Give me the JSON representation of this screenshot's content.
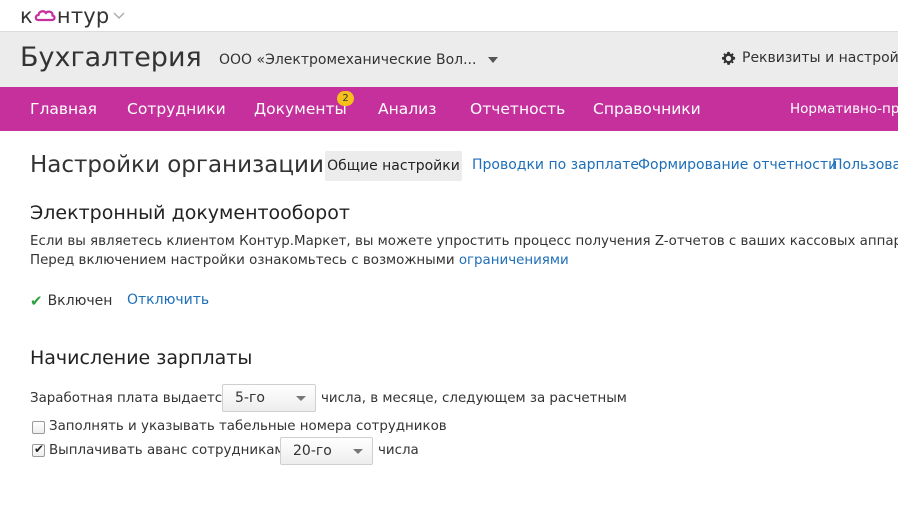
{
  "logo": {
    "text_before": "к",
    "text_after": "нтур"
  },
  "header": {
    "app_title": "Бухгалтерия",
    "organization": "ООО «Электромеханические Вол...",
    "settings_label": "Реквизиты и настройки"
  },
  "nav": {
    "items": [
      {
        "label": "Главная"
      },
      {
        "label": "Сотрудники"
      },
      {
        "label": "Документы",
        "badge": "2"
      },
      {
        "label": "Анализ"
      },
      {
        "label": "Отчетность"
      },
      {
        "label": "Справочники"
      },
      {
        "label": "Нормативно-пра"
      }
    ]
  },
  "page": {
    "title": "Настройки организации",
    "tabs": [
      {
        "label": "Общие настройки",
        "active": true
      },
      {
        "label": "Проводки по зарплате"
      },
      {
        "label": "Формирование отчетности"
      },
      {
        "label": "Пользоват"
      }
    ]
  },
  "edo": {
    "title": "Электронный документооборот",
    "line1": "Если вы являетесь клиентом Контур.Маркет, вы можете упростить процесс получения Z-отчетов с ваших кассовых аппаратов.",
    "line2": "Перед включением настройки ознакомьтесь с возможными ",
    "link": "ограничениями",
    "status": "Включен",
    "disable_label": "Отключить"
  },
  "salary": {
    "title": "Начисление зарплаты",
    "paid_label": "Заработная плата выдается:",
    "paid_select": "5-го",
    "paid_suffix": "числа, в месяце, следующем за расчетным",
    "tabnum_label": "Заполнять и указывать табельные номера сотрудников",
    "tabnum_checked": false,
    "advance_label": "Выплачивать аванс сотрудникам",
    "advance_checked": true,
    "advance_select": "20-го",
    "advance_suffix": "числа"
  },
  "colors": {
    "brand": "#c5309c",
    "link": "#1e6fb8",
    "badge": "#f6c01c",
    "check": "#2e9e3e"
  }
}
